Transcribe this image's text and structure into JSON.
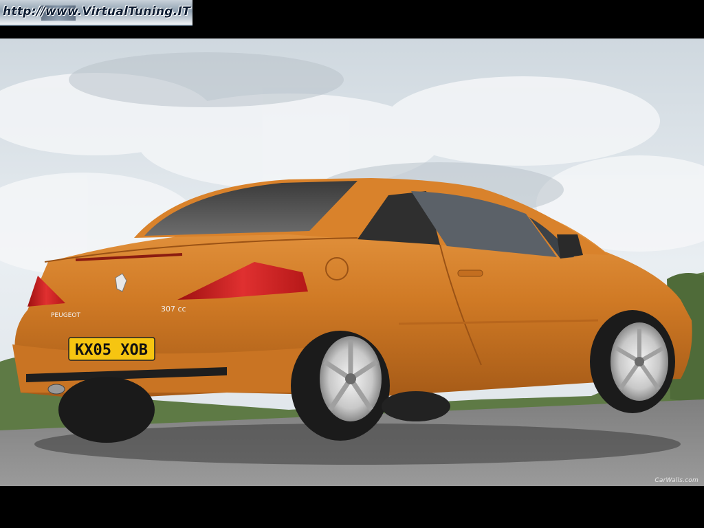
{
  "banner": {
    "text": "http://www.VirtualTuning.IT"
  },
  "watermark": {
    "text": "CarWalls.com"
  },
  "car": {
    "badge_brand": "PEUGEOT",
    "badge_model": "307 cc",
    "plate": "KX05 XOB",
    "body_color": "#d9822b"
  },
  "colors": {
    "frame": "#000000",
    "sky": "#dfe5ea",
    "road": "#8c8c8c"
  }
}
